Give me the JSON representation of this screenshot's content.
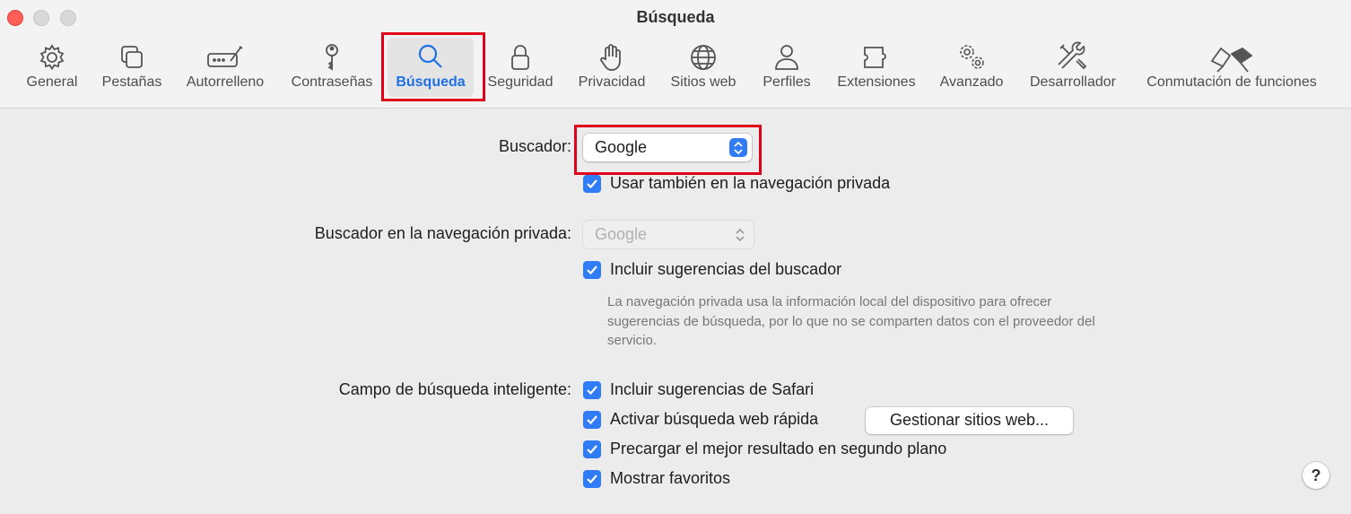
{
  "window": {
    "title": "Búsqueda"
  },
  "toolbar": {
    "tabs": [
      {
        "label": "General",
        "icon": "gear-icon"
      },
      {
        "label": "Pestañas",
        "icon": "tabs-icon"
      },
      {
        "label": "Autorrelleno",
        "icon": "autofill-icon"
      },
      {
        "label": "Contraseñas",
        "icon": "key-icon"
      },
      {
        "label": "Búsqueda",
        "icon": "search-icon",
        "active": true
      },
      {
        "label": "Seguridad",
        "icon": "lock-icon"
      },
      {
        "label": "Privacidad",
        "icon": "hand-icon"
      },
      {
        "label": "Sitios web",
        "icon": "globe-icon"
      },
      {
        "label": "Perfiles",
        "icon": "person-icon"
      },
      {
        "label": "Extensiones",
        "icon": "puzzle-icon"
      },
      {
        "label": "Avanzado",
        "icon": "gears-icon"
      },
      {
        "label": "Desarrollador",
        "icon": "tools-icon"
      },
      {
        "label": "Conmutación de funciones",
        "icon": "flags-icon"
      }
    ]
  },
  "search": {
    "engine_label": "Buscador:",
    "engine_value": "Google",
    "use_private_label": "Usar también en la navegación privada",
    "private_engine_label": "Buscador en la navegación privada:",
    "private_engine_value": "Google",
    "include_suggestions_label": "Incluir sugerencias del buscador",
    "note": "La navegación privada usa la información local del dispositivo para ofrecer sugerencias de búsqueda, por lo que no se comparten datos con el proveedor del servicio.",
    "smart_field_label": "Campo de búsqueda inteligente:",
    "safari_suggestions_label": "Incluir sugerencias de Safari",
    "quick_search_label": "Activar búsqueda web rápida",
    "manage_sites_button": "Gestionar sitios web...",
    "preload_label": "Precargar el mejor resultado en segundo plano",
    "show_favorites_label": "Mostrar favoritos",
    "help_label": "?"
  },
  "colors": {
    "accent": "#2f7cf6",
    "highlight": "#e0001a"
  }
}
